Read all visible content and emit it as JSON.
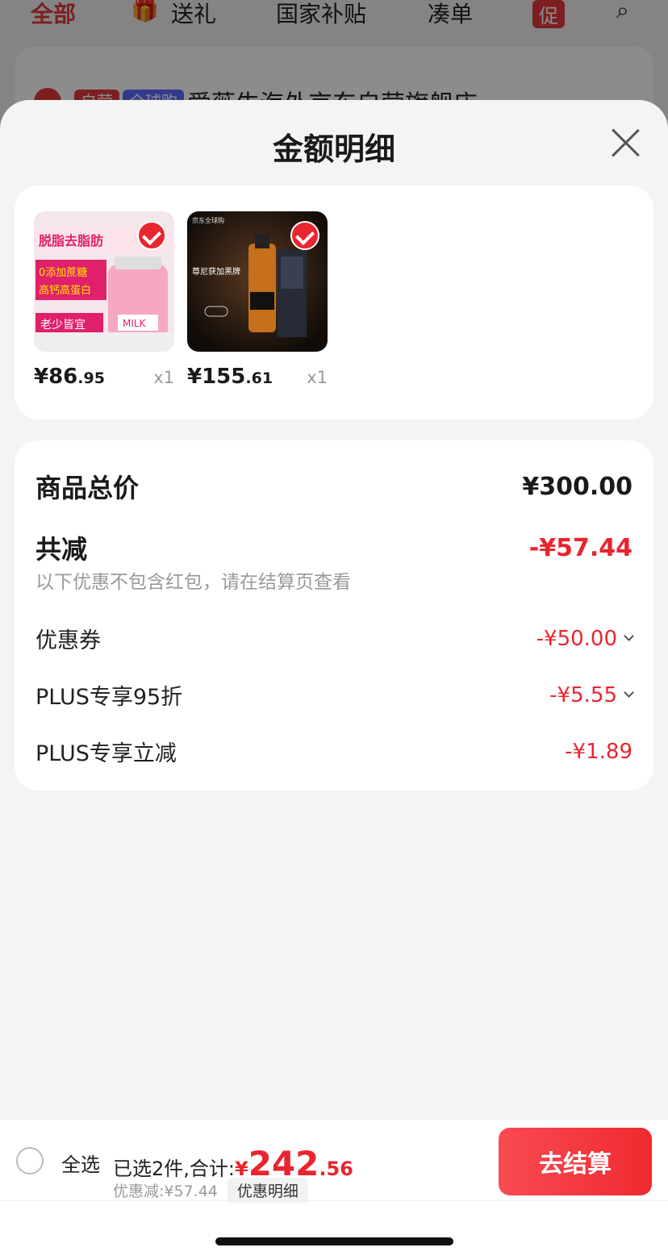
{
  "background": {
    "tabs": [
      "全部",
      "送礼",
      "国家补贴",
      "凑单",
      "促"
    ],
    "store_tags": [
      "自营",
      "全球购"
    ],
    "store_name": "爱薇牛海外京东自营旗舰店 ›"
  },
  "sheet": {
    "title": "金额明细"
  },
  "products": [
    {
      "price_int": "¥86",
      "price_dec": ".95",
      "qty": "x1",
      "image_icon": "milk-powder-product-image"
    },
    {
      "price_int": "¥155",
      "price_dec": ".61",
      "qty": "x1",
      "image_icon": "whisky-product-image"
    }
  ],
  "summary": {
    "total_label": "商品总价",
    "total_value": "¥300.00",
    "reduce_label": "共减",
    "reduce_value": "-¥57.44",
    "hint": "以下优惠不包含红包，请在结算页查看",
    "items": [
      {
        "label": "优惠券",
        "value": "-¥50.00",
        "expandable": true
      },
      {
        "label": "PLUS专享95折",
        "value": "-¥5.55",
        "expandable": true
      },
      {
        "label": "PLUS专享立减",
        "value": "-¥1.89",
        "expandable": false
      }
    ]
  },
  "bottom": {
    "select_all": "全选",
    "selected_text": "已选2件,合计:",
    "total_sym": "¥",
    "total_int": "242",
    "total_dec": ".56",
    "discount_text": "优惠减:¥57.44",
    "detail_link": "优惠明细",
    "checkout": "去结算"
  },
  "colors": {
    "accent": "#e9252f",
    "sheet_bg": "#f4f4f4"
  }
}
